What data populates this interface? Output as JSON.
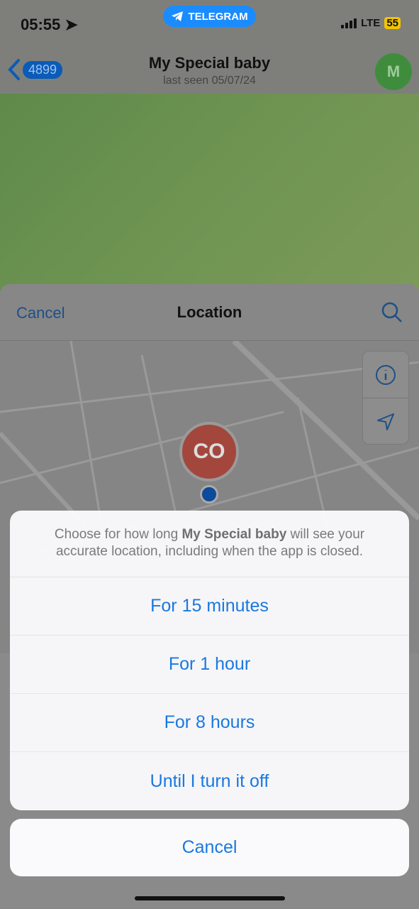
{
  "status_bar": {
    "time": "05:55",
    "app_pill": "TELEGRAM",
    "network": "LTE",
    "battery": "55"
  },
  "chat_header": {
    "back_count": "4899",
    "title": "My Special baby",
    "subtitle": "last seen 05/07/24",
    "avatar_initial": "M"
  },
  "location_sheet": {
    "cancel_label": "Cancel",
    "title": "Location",
    "pin_initials": "CO"
  },
  "alert": {
    "message_prefix": "Choose for how long ",
    "message_name": "My Special baby",
    "message_suffix": " will see your accurate location, including when the app is closed.",
    "options": [
      {
        "label": "For 15 minutes"
      },
      {
        "label": "For 1 hour"
      },
      {
        "label": "For 8 hours"
      },
      {
        "label": "Until I turn it off"
      }
    ],
    "cancel_label": "Cancel"
  },
  "colors": {
    "accent": "#1a78e0",
    "telegram_pill": "#1a8cff"
  }
}
